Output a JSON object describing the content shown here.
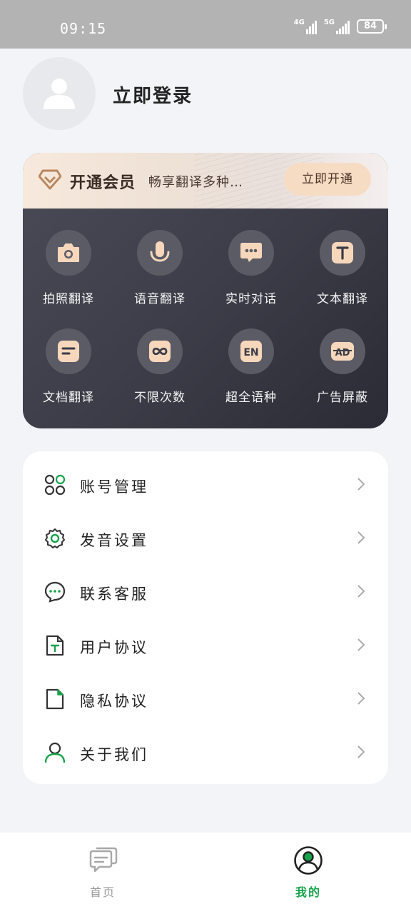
{
  "status_bar": {
    "time": "09:15",
    "net1": "4G",
    "net2": "5G",
    "battery": "84"
  },
  "profile": {
    "login_text": "立即登录"
  },
  "vip": {
    "title": "开通会员",
    "subtitle": "畅享翻译多种…",
    "button_label": "立即开通",
    "features": [
      {
        "label": "拍照翻译",
        "icon": "camera-icon"
      },
      {
        "label": "语音翻译",
        "icon": "microphone-icon"
      },
      {
        "label": "实时对话",
        "icon": "chat-icon"
      },
      {
        "label": "文本翻译",
        "icon": "text-icon"
      },
      {
        "label": "文档翻译",
        "icon": "document-icon"
      },
      {
        "label": "不限次数",
        "icon": "infinity-icon"
      },
      {
        "label": "超全语种",
        "icon": "en-icon"
      },
      {
        "label": "广告屏蔽",
        "icon": "ad-block-icon"
      }
    ]
  },
  "menu": {
    "items": [
      {
        "label": "账号管理",
        "icon": "account-icon"
      },
      {
        "label": "发音设置",
        "icon": "gear-icon"
      },
      {
        "label": "联系客服",
        "icon": "service-icon"
      },
      {
        "label": "用户协议",
        "icon": "agreement-icon"
      },
      {
        "label": "隐私协议",
        "icon": "privacy-icon"
      },
      {
        "label": "关于我们",
        "icon": "about-icon"
      }
    ]
  },
  "tabs": [
    {
      "label": "首页",
      "icon": "home-chat-icon",
      "active": false
    },
    {
      "label": "我的",
      "icon": "profile-icon",
      "active": true
    }
  ],
  "colors": {
    "accent_green": "#16a34a",
    "vip_gold": "#f7dcc4",
    "inactive_tab": "#9a9a9a"
  }
}
